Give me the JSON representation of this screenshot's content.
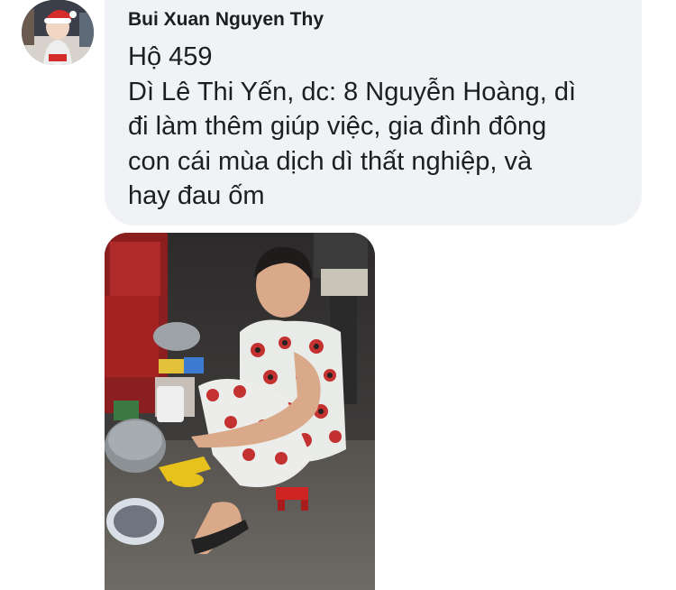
{
  "comment": {
    "author": "Bui Xuan Nguyen Thy",
    "lines": [
      "Hộ 459",
      "Dì Lê Thi Yến, dc: 8 Nguyễn Hoàng, dì",
      "đi làm thêm giúp việc, gia đình đông",
      "con cái mùa dịch dì thất nghiệp, và",
      "hay đau ốm"
    ]
  },
  "colors": {
    "bubble_bg": "#f0f2f5",
    "text": "#1c1e21"
  },
  "icons": {
    "avatar": "profile-photo",
    "attachment": "photo"
  }
}
